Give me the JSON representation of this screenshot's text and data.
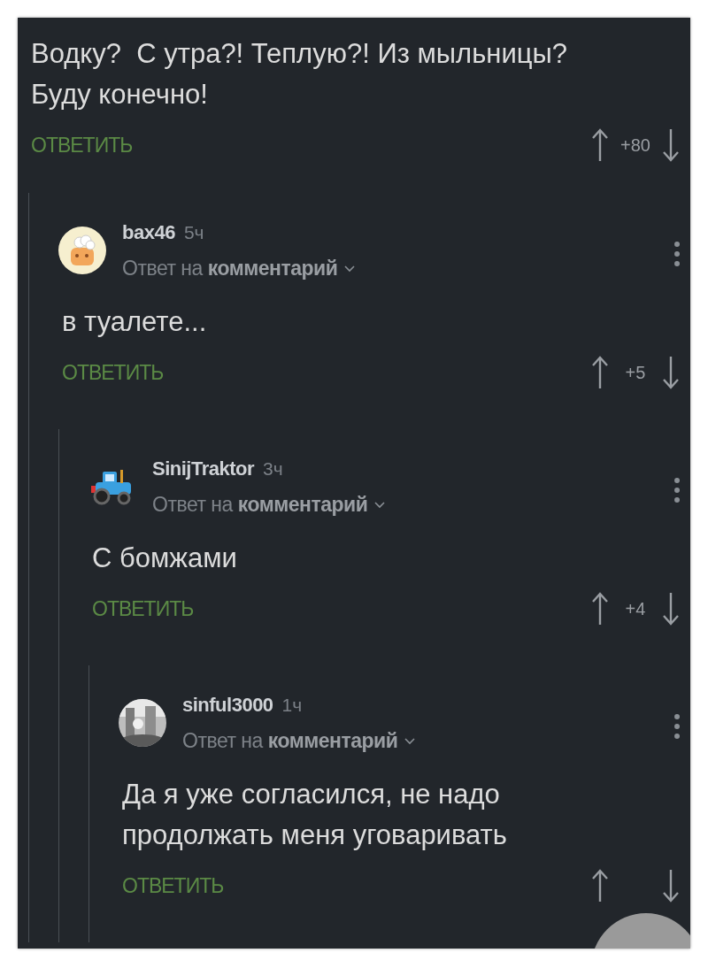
{
  "thread": {
    "text": "Водку?  С утра?! Теплую?! Из мыльницы? Буду конечно!",
    "reply_label": "ОТВЕТИТЬ",
    "score": "+80",
    "children": [
      {
        "author": "bax46",
        "time": "5ч",
        "avatar": {
          "kind": "cartoon"
        },
        "reply_to": "Ответ на **комментарий**",
        "text": "в туалете...",
        "reply_label": "ОТВЕТИТЬ",
        "score": "+5",
        "children": [
          {
            "author": "SinijTraktor",
            "time": "3ч",
            "avatar": {
              "kind": "tractor"
            },
            "reply_to": "Ответ на **комментарий**",
            "text": "С бомжами",
            "reply_label": "ОТВЕТИТЬ",
            "score": "+4",
            "children": [
              {
                "author": "sinful3000",
                "time": "1ч",
                "reply_to": "Ответ на **комментарий**",
                "text": "Да я уже согласился, не надо продолжать меня уговаривать",
                "reply_label": "ОТВЕТИТЬ"
              }
            ]
          }
        ]
      }
    ]
  }
}
